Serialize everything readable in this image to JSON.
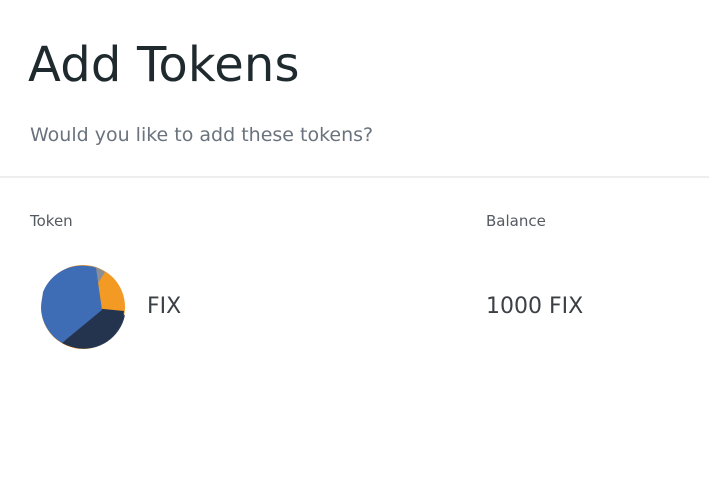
{
  "header": {
    "title": "Add Tokens",
    "subtitle": "Would you like to add these tokens?"
  },
  "table": {
    "columns": {
      "token": "Token",
      "balance": "Balance"
    },
    "rows": [
      {
        "icon": "fix-token-logo-icon",
        "symbol": "FIX",
        "balance": "1000 FIX"
      }
    ]
  },
  "colors": {
    "logo_blue": "#3f6db5",
    "logo_orange": "#f29a24",
    "logo_navy": "#24344e",
    "logo_gray": "#8a8f96"
  }
}
